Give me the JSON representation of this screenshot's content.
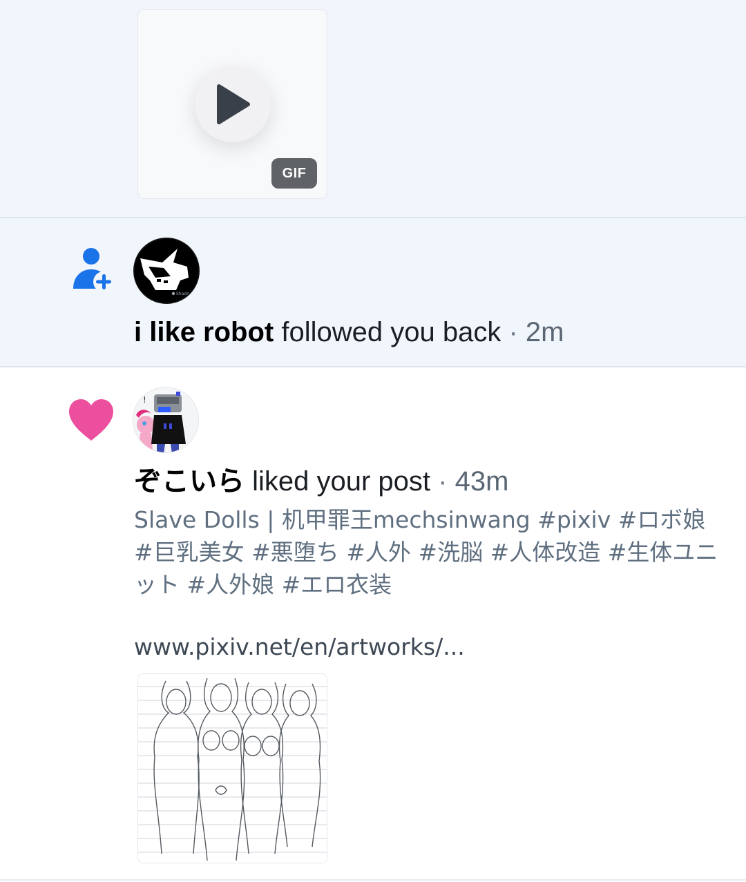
{
  "gif_post": {
    "badge_label": "GIF",
    "play_icon": "play-icon"
  },
  "follow_notification": {
    "icon": "person-plus-icon",
    "icon_color": "#1a73e8",
    "actor": "i like robot",
    "action": "followed you back",
    "separator": "·",
    "time": "2m",
    "avatar_caption": "Shaded"
  },
  "like_notification": {
    "icon": "heart-icon",
    "icon_color": "#ec4f9e",
    "actor": "ぞこいら",
    "action": "liked your post",
    "separator": "·",
    "time": "43m",
    "post_text": "Slave Dolls | 机甲罪王mechsinwang #pixiv #ロボ娘 #巨乳美女 #悪堕ち #人外 #洗脳 #人体改造 #生体ユニット #人外娘 #エロ衣装",
    "post_link": "www.pixiv.net/en/artworks/..."
  },
  "colors": {
    "highlight_bg": "#f1f5fc",
    "divider": "#dfe6ef",
    "secondary_text": "#5f6f80"
  }
}
